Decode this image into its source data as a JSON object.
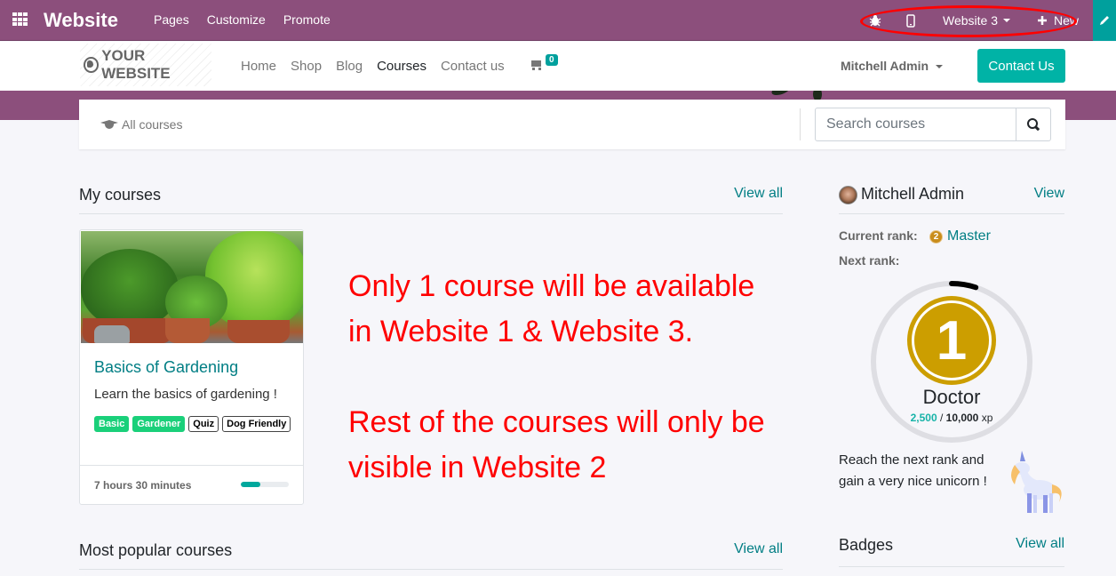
{
  "admin_bar": {
    "app_name": "Website",
    "menu": [
      "Pages",
      "Customize",
      "Promote"
    ],
    "website_switcher": "Website 3",
    "new_label": "New"
  },
  "site_header": {
    "logo_text": "YOUR WEBSITE",
    "nav": [
      "Home",
      "Shop",
      "Blog",
      "Courses",
      "Contact us"
    ],
    "active_nav": "Courses",
    "cart_count": "0",
    "user_name": "Mitchell Admin",
    "contact_button": "Contact Us"
  },
  "search_bar": {
    "all_courses_label": "All courses",
    "placeholder": "Search courses"
  },
  "my_courses": {
    "title": "My courses",
    "view_all": "View all",
    "courses": [
      {
        "title": "Basics of Gardening",
        "description": "Learn the basics of gardening !",
        "tags": [
          {
            "label": "Basic",
            "style": "filled"
          },
          {
            "label": "Gardener",
            "style": "filled"
          },
          {
            "label": "Quiz",
            "style": "outline"
          },
          {
            "label": "Dog Friendly",
            "style": "outline"
          }
        ],
        "duration": "7 hours 30 minutes",
        "progress_percent": 40
      }
    ]
  },
  "popular_courses": {
    "title": "Most popular courses",
    "view_all": "View all"
  },
  "annotation": {
    "color": "#ff0000",
    "lines": [
      "Only 1 course will be available",
      "in Website 1 & Website 3.",
      "Rest of the courses will only be",
      "visible in Website 2"
    ]
  },
  "profile": {
    "name": "Mitchell Admin",
    "view_label": "View",
    "current_rank_label": "Current rank:",
    "current_rank_number": "2",
    "current_rank": "Master",
    "next_rank_label": "Next rank:",
    "next_rank_number": "1",
    "next_rank": "Doctor",
    "xp_current": "2,500",
    "xp_separator": "/",
    "xp_max": "10,000",
    "xp_unit": "xp",
    "xp_progress_fraction": 0.25,
    "reward_text": "Reach the next rank and gain a very nice unicorn !"
  },
  "badges": {
    "title": "Badges",
    "view_all": "View all"
  },
  "colors": {
    "brand_purple": "#8c4f7c",
    "accent_teal": "#00a09d",
    "link_teal": "#017e84",
    "medal_gold": "#cc9e00",
    "tag_green": "#1ad07a"
  }
}
